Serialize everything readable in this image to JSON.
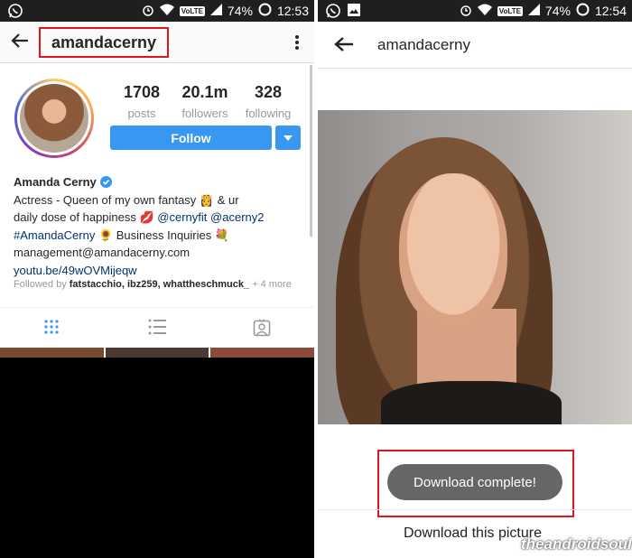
{
  "left": {
    "status_bar": {
      "battery": "74%",
      "time": "12:53",
      "network": "VoLTE"
    },
    "header": {
      "username": "amandacerny"
    },
    "stats": [
      {
        "value": "1708",
        "label": "posts"
      },
      {
        "value": "20.1m",
        "label": "followers"
      },
      {
        "value": "328",
        "label": "following"
      }
    ],
    "follow_label": "Follow",
    "bio": {
      "name": "Amanda Cerny",
      "line1": "Actress - Queen of my own fantasy 👸 & ur",
      "line2_text": "daily dose of happiness 💋 ",
      "mention1": "@cernyfit",
      "mention2": "@acerny2",
      "hashtag": "#AmandaCerny",
      "line3_rest": " 🌻 Business Inquiries 💐",
      "email": "management@amandacerny.com",
      "website": "youtu.be/49wOVMijeqw"
    },
    "followed_by": {
      "prefix": "Followed by ",
      "users": "fatstacchio, ibz259, whattheschmuck_",
      "suffix": " + 4 more"
    }
  },
  "right": {
    "status_bar": {
      "battery": "74%",
      "time": "12:54",
      "network": "VoLTE"
    },
    "header": {
      "username": "amandacerny"
    },
    "toast": "Download complete!",
    "download_label": "Download this picture",
    "watermark": "theandroidsoul"
  },
  "colors": {
    "accent": "#3897f0",
    "highlight": "#e0141e",
    "statusbar": "#1f1f1f"
  }
}
